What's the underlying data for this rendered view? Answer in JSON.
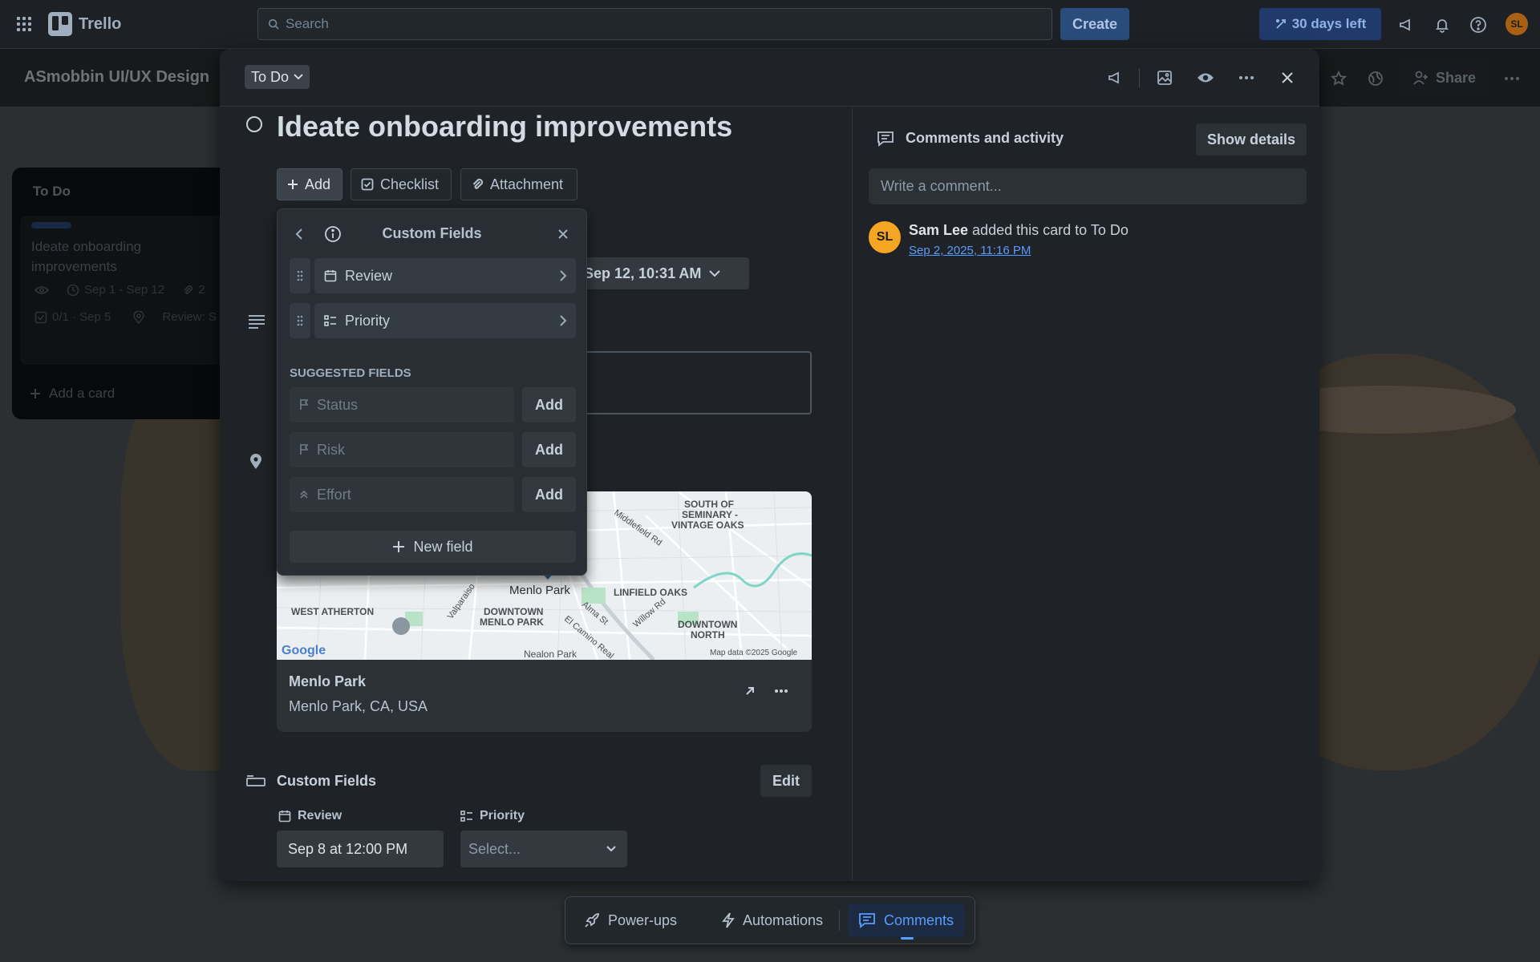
{
  "topbar": {
    "app_name": "Trello",
    "search_placeholder": "Search",
    "create_label": "Create",
    "trial_label": "30 days left",
    "user_initials": "SL"
  },
  "board": {
    "title": "ASmobbin UI/UX Design",
    "share_label": "Share",
    "list": {
      "title": "To Do",
      "card": {
        "title": "Ideate onboarding improvements",
        "dates": "Sep 1 - Sep 12",
        "attachments": "2",
        "checklist": "0/1 · Sep 5",
        "review": "Review: S"
      },
      "add_card_label": "Add a card"
    }
  },
  "modal": {
    "status": "To Do",
    "title": "Ideate onboarding improvements",
    "actions": {
      "add": "Add",
      "checklist": "Checklist",
      "attachment": "Attachment"
    },
    "due_date": "Sep 12, 10:31 AM",
    "location": {
      "name": "Menlo Park",
      "address": "Menlo Park, CA, USA",
      "map_labels": {
        "south_of_seminary": "SOUTH OF",
        "seminary": "SEMINARY -",
        "vintage_oaks": "VINTAGE OAKS",
        "middlefield": "Middlefield Rd",
        "menlo_park": "Menlo Park",
        "linfield_oaks": "LINFIELD OAKS",
        "west_atherton": "WEST ATHERTON",
        "downtown_mp_1": "DOWNTOWN",
        "downtown_mp_2": "MENLO PARK",
        "downtown_north_1": "DOWNTOWN",
        "downtown_north_2": "NORTH",
        "valparaiso": "Valparaiso",
        "alma": "Alma St",
        "el_camino": "El Camino Real",
        "willow": "Willow Rd",
        "nealon": "Nealon Park",
        "google": "Google",
        "map_data": "Map data ©2025 Google"
      }
    },
    "custom_fields": {
      "title": "Custom Fields",
      "edit_label": "Edit",
      "review_label": "Review",
      "review_value": "Sep 8 at 12:00 PM",
      "priority_label": "Priority",
      "priority_value": "Select..."
    }
  },
  "activity": {
    "title": "Comments and activity",
    "show_details": "Show details",
    "comment_placeholder": "Write a comment...",
    "entries": [
      {
        "initials": "SL",
        "user": "Sam Lee",
        "action": " added this card to To Do",
        "time": "Sep 2, 2025, 11:16 PM"
      }
    ]
  },
  "popover": {
    "title": "Custom Fields",
    "fields": [
      {
        "label": "Review"
      },
      {
        "label": "Priority"
      }
    ],
    "suggested_label": "SUGGESTED FIELDS",
    "suggested": [
      {
        "label": "Status",
        "add": "Add"
      },
      {
        "label": "Risk",
        "add": "Add"
      },
      {
        "label": "Effort",
        "add": "Add"
      }
    ],
    "new_field": "New field"
  },
  "dock": {
    "powerups": "Power-ups",
    "automations": "Automations",
    "comments": "Comments"
  },
  "colors": {
    "accent": "#579dff",
    "avatar": "#f5a623",
    "modal_bg": "#1f2226"
  }
}
